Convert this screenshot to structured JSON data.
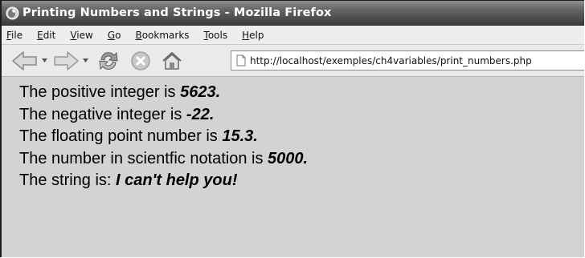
{
  "window": {
    "title": "Printing Numbers and Strings - Mozilla Firefox"
  },
  "menu": {
    "items": [
      {
        "label": "File",
        "accel": "F",
        "rest": "ile"
      },
      {
        "label": "Edit",
        "accel": "E",
        "rest": "dit"
      },
      {
        "label": "View",
        "accel": "V",
        "rest": "iew"
      },
      {
        "label": "Go",
        "accel": "G",
        "rest": "o"
      },
      {
        "label": "Bookmarks",
        "accel": "B",
        "rest": "ookmarks"
      },
      {
        "label": "Tools",
        "accel": "T",
        "rest": "ools"
      },
      {
        "label": "Help",
        "accel": "H",
        "rest": "elp"
      }
    ]
  },
  "toolbar": {
    "icons": [
      "back-icon",
      "forward-icon",
      "reload-icon",
      "stop-icon",
      "home-icon",
      "page-icon"
    ],
    "url": "http://localhost/exemples/ch4variables/print_numbers.php"
  },
  "content": {
    "lines": [
      {
        "text": "The positive integer is ",
        "value": "5623."
      },
      {
        "text": "The negative integer is ",
        "value": "-22."
      },
      {
        "text": "The floating point number is ",
        "value": "15.3."
      },
      {
        "text": "The number in scientfic notation is ",
        "value": "5000."
      },
      {
        "text": "The string is: ",
        "value": "I can't help you!"
      }
    ]
  },
  "colors": {
    "title_bar": "#3c3c3c",
    "content_bg": "#d3d3d3",
    "menu_bg": "#eeeeee"
  }
}
